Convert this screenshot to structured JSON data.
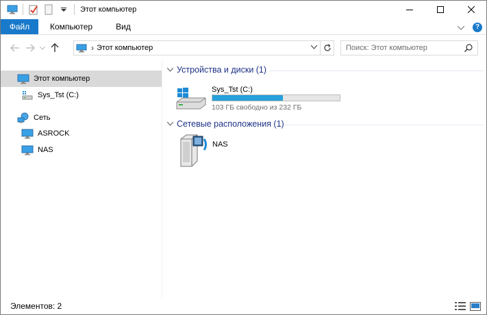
{
  "window": {
    "title": "Этот компьютер"
  },
  "ribbon": {
    "tabs": [
      {
        "label": "Файл"
      },
      {
        "label": "Компьютер"
      },
      {
        "label": "Вид"
      }
    ],
    "help_label": "?"
  },
  "address": {
    "separator": "›",
    "path": "Этот компьютер"
  },
  "search": {
    "placeholder": "Поиск: Этот компьютер"
  },
  "sidebar": {
    "items": [
      {
        "label": "Этот компьютер",
        "icon": "computer-icon",
        "selected": true
      },
      {
        "label": "Sys_Tst (C:)",
        "icon": "drive-icon"
      },
      {
        "label": "Сеть",
        "icon": "network-icon"
      },
      {
        "label": "ASROCK",
        "icon": "computer-icon"
      },
      {
        "label": "NAS",
        "icon": "computer-icon"
      }
    ]
  },
  "main": {
    "groups": [
      {
        "title": "Устройства и диски (1)"
      },
      {
        "title": "Сетевые расположения (1)"
      }
    ],
    "drive": {
      "name": "Sys_Tst (C:)",
      "free_text": "103 ГБ свободно из 232 ГБ",
      "used_fraction": 0.556
    },
    "network_location": {
      "name": "NAS"
    }
  },
  "status": {
    "items_text": "Элементов: 2"
  },
  "colors": {
    "accent": "#1979ca",
    "group_title": "#1e3287",
    "capacity_fill": "#26a0da",
    "selected_bg": "#d9d9d9"
  }
}
